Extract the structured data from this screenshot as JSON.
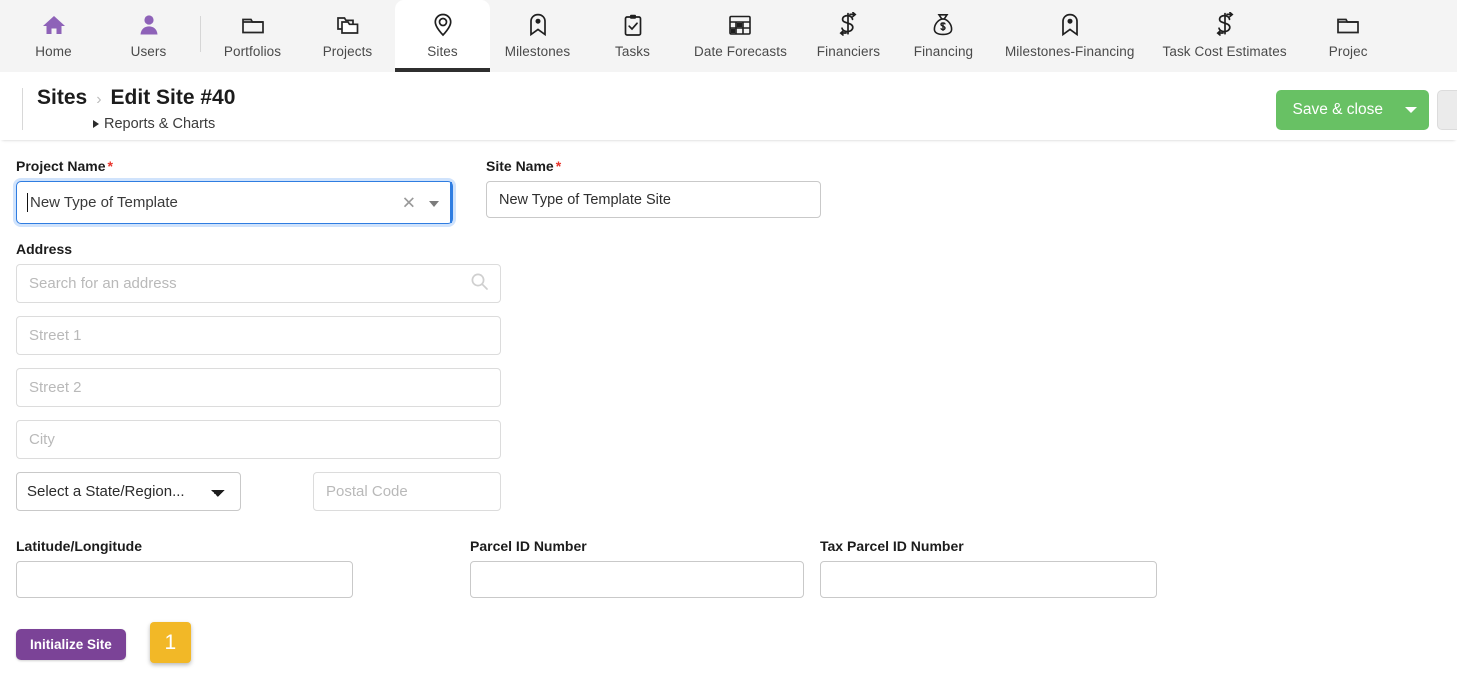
{
  "nav": {
    "items": [
      {
        "label": "Home",
        "icon": "home-icon",
        "accent": true,
        "active": false
      },
      {
        "label": "Users",
        "icon": "user-icon",
        "accent": true,
        "active": false
      },
      {
        "label": "Portfolios",
        "icon": "folder-icon",
        "accent": false,
        "active": false
      },
      {
        "label": "Projects",
        "icon": "folders-icon",
        "accent": false,
        "active": false
      },
      {
        "label": "Sites",
        "icon": "map-pin-icon",
        "accent": false,
        "active": true
      },
      {
        "label": "Milestones",
        "icon": "milestone-pin-icon",
        "accent": false,
        "active": false
      },
      {
        "label": "Tasks",
        "icon": "clipboard-check-icon",
        "accent": false,
        "active": false
      },
      {
        "label": "Date Forecasts",
        "icon": "calendar-icon",
        "accent": false,
        "active": false
      },
      {
        "label": "Financiers",
        "icon": "dollar-exchange-icon",
        "accent": false,
        "active": false
      },
      {
        "label": "Financing",
        "icon": "money-bag-icon",
        "accent": false,
        "active": false
      },
      {
        "label": "Milestones-Financing",
        "icon": "milestone-pin-icon",
        "accent": false,
        "active": false
      },
      {
        "label": "Task Cost Estimates",
        "icon": "dollar-exchange-icon",
        "accent": false,
        "active": false
      },
      {
        "label": "Projec",
        "icon": "folder-icon",
        "accent": false,
        "active": false
      }
    ]
  },
  "header": {
    "breadcrumb_root": "Sites",
    "breadcrumb_sep": "›",
    "breadcrumb_current": "Edit Site #40",
    "sub_link": "Reports & Charts",
    "save_label": "Save & close",
    "accent_green": "#68c164"
  },
  "form": {
    "project_name": {
      "label": "Project Name",
      "required": "*",
      "value": "New Type of Template",
      "clear_glyph": "✕",
      "focused": true
    },
    "site_name": {
      "label": "Site Name",
      "required": "*",
      "value": "New Type of Template Site"
    },
    "address": {
      "label": "Address",
      "search_placeholder": "Search for an address",
      "street1_placeholder": "Street 1",
      "street2_placeholder": "Street 2",
      "city_placeholder": "City",
      "state_selected": "Select a State/Region...",
      "state_options": [
        "Select a State/Region..."
      ],
      "postal_placeholder": "Postal Code"
    },
    "latlong": {
      "label": "Latitude/Longitude",
      "value": ""
    },
    "parcel_id": {
      "label": "Parcel ID Number",
      "value": ""
    },
    "tax_parcel_id": {
      "label": "Tax Parcel ID Number",
      "value": ""
    },
    "initialize_label": "Initialize Site",
    "step_badge": "1",
    "badge_color": "#f2b827",
    "button_color": "#7b4397"
  }
}
